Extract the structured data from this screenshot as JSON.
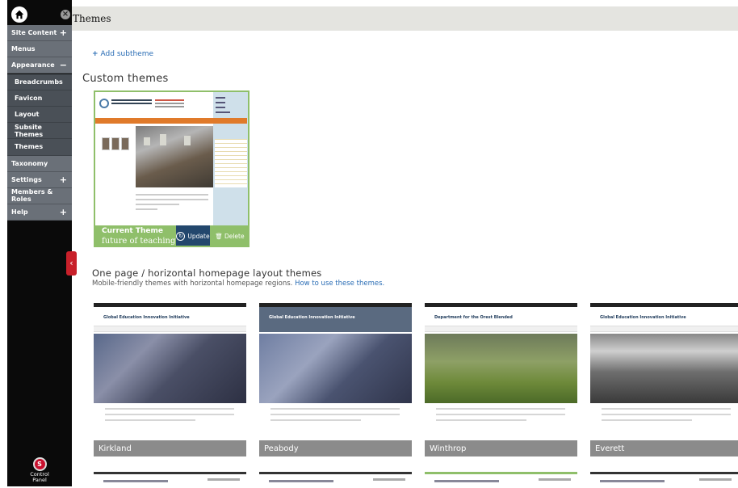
{
  "header": {
    "title": "Themes"
  },
  "sidebar": {
    "items": [
      {
        "label": "Site Content",
        "toggle": "+"
      },
      {
        "label": "Menus",
        "toggle": ""
      },
      {
        "label": "Appearance",
        "toggle": "−"
      },
      {
        "label": "Breadcrumbs",
        "sub": true
      },
      {
        "label": "Favicon",
        "sub": true
      },
      {
        "label": "Layout",
        "sub": true
      },
      {
        "label": "Subsite Themes",
        "sub": true
      },
      {
        "label": "Themes",
        "sub": true
      },
      {
        "label": "Taxonomy",
        "toggle": ""
      },
      {
        "label": "Settings",
        "toggle": "+"
      },
      {
        "label": "Members & Roles",
        "toggle": ""
      },
      {
        "label": "Help",
        "toggle": "+"
      }
    ],
    "control_panel_label": "Control Panel"
  },
  "actions": {
    "add_subtheme": "Add subtheme"
  },
  "custom": {
    "heading": "Custom themes",
    "card": {
      "current_label": "Current Theme",
      "name": "future of teaching",
      "update_label": "Update",
      "delete_label": "Delete"
    }
  },
  "onepage": {
    "heading": "One page / horizontal homepage layout themes",
    "description": "Mobile-friendly themes with horizontal homepage regions.",
    "link": "How to use these themes.",
    "themes": [
      {
        "name": "Kirkland",
        "site": "Global Education Innovation Initiative"
      },
      {
        "name": "Peabody",
        "site": "Global Education Innovation Initiative"
      },
      {
        "name": "Winthrop",
        "site": "Department for the Orest Blended"
      },
      {
        "name": "Everett",
        "site": "Global Education Innovation Initiative"
      }
    ]
  },
  "colors": {
    "accent_green": "#8fbf6a",
    "update_blue": "#23476d",
    "link_blue": "#2a6db5"
  }
}
